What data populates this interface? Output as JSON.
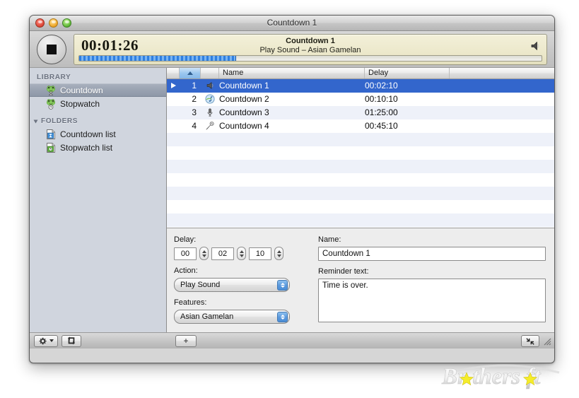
{
  "window": {
    "title": "Countdown 1",
    "controls": {
      "close": "close-button",
      "minimize": "minimize-button",
      "zoom": "zoom-button"
    }
  },
  "toolbar": {
    "stop_button": "Stop",
    "display": {
      "time": "00:01:26",
      "name": "Countdown 1",
      "subtitle": "Play Sound – Asian Gamelan",
      "progress_percent": 34,
      "speaker_icon": "speaker-icon"
    }
  },
  "sidebar": {
    "sections": [
      {
        "header": "LIBRARY",
        "collapsible": false,
        "items": [
          {
            "label": "Countdown",
            "icon": "frog-hourglass-icon",
            "selected": true
          },
          {
            "label": "Stopwatch",
            "icon": "frog-clock-icon",
            "selected": false
          }
        ]
      },
      {
        "header": "FOLDERS",
        "collapsible": true,
        "items": [
          {
            "label": "Countdown list",
            "icon": "document-hourglass-icon",
            "selected": false
          },
          {
            "label": "Stopwatch list",
            "icon": "document-clock-icon",
            "selected": false
          }
        ]
      }
    ]
  },
  "table": {
    "columns": [
      {
        "label": "",
        "key": "play",
        "sorted": false
      },
      {
        "label": "",
        "key": "num",
        "sorted": true,
        "sort_direction": "asc"
      },
      {
        "label": "",
        "key": "icon",
        "sorted": false
      },
      {
        "label": "Name",
        "key": "name",
        "sorted": false
      },
      {
        "label": "Delay",
        "key": "delay",
        "sorted": false
      },
      {
        "label": "",
        "key": "spare",
        "sorted": false
      }
    ],
    "rows": [
      {
        "num": "1",
        "icon": "speaker-icon",
        "name": "Countdown 1",
        "delay": "00:02:10",
        "selected": true,
        "playing": true
      },
      {
        "num": "2",
        "icon": "music-note-icon",
        "name": "Countdown 2",
        "delay": "00:10:10",
        "selected": false,
        "playing": false
      },
      {
        "num": "3",
        "icon": "microphone-icon",
        "name": "Countdown 3",
        "delay": "01:25:00",
        "selected": false,
        "playing": false
      },
      {
        "num": "4",
        "icon": "mic-alt-icon",
        "name": "Countdown 4",
        "delay": "00:45:10",
        "selected": false,
        "playing": false
      }
    ],
    "empty_row_count": 8
  },
  "inspector": {
    "delay_label": "Delay:",
    "delay_hours": "00",
    "delay_minutes": "02",
    "delay_seconds": "10",
    "action_label": "Action:",
    "action_value": "Play Sound",
    "features_label": "Features:",
    "features_value": "Asian Gamelan",
    "name_label": "Name:",
    "name_value": "Countdown 1",
    "reminder_label": "Reminder text:",
    "reminder_value": "Time is over."
  },
  "bottombar": {
    "gear_button": "gear-action-button",
    "repeat_button": "repeat-button",
    "add_button": "+",
    "collapse_button": "collapse-button",
    "resize_grip": "resize-grip"
  },
  "watermark": {
    "text": "Brothersoft"
  },
  "colors": {
    "selection_blue": "#3366cc",
    "sorted_header_blue": "#9cc7ef",
    "display_cream": "#ebe7c9",
    "progress_blue": "#2f7fe0",
    "sidebar_bg": "#d0d5de",
    "alt_row": "#eef1f9"
  }
}
